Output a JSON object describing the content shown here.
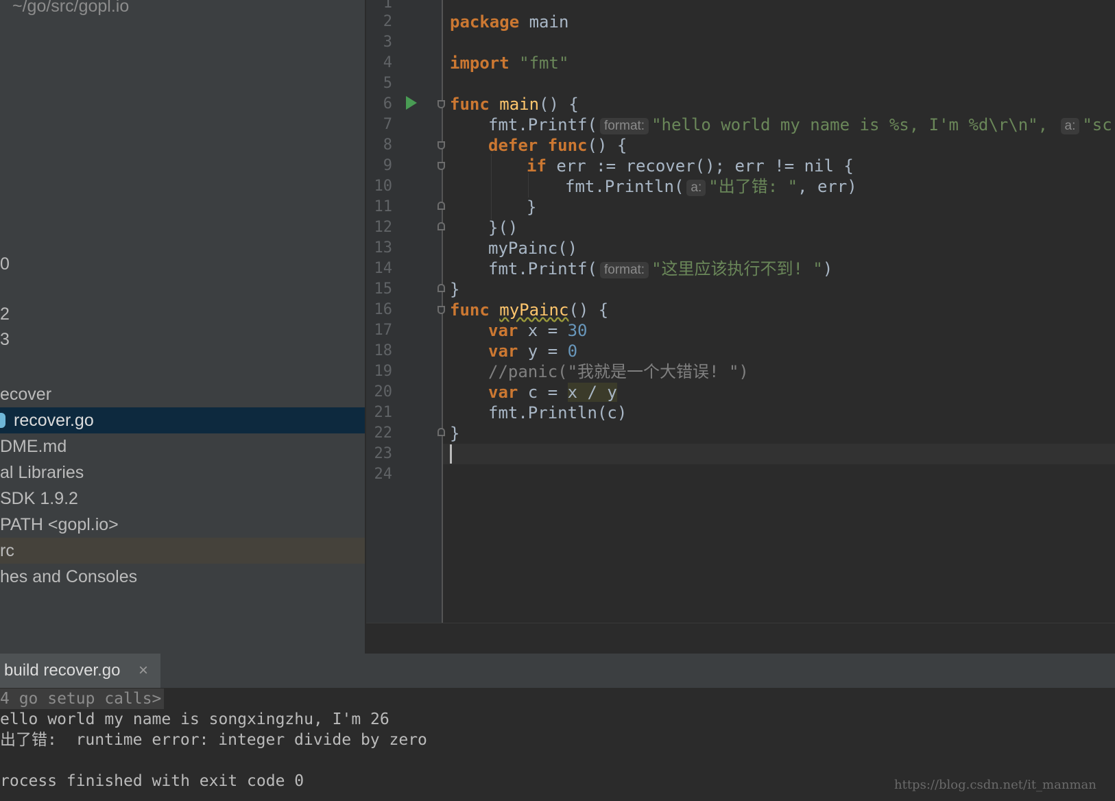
{
  "sidebar": {
    "path_hint": "~/go/src/gopl.io",
    "items": [
      {
        "label": "0"
      },
      {
        "label": "2"
      },
      {
        "label": "3"
      },
      {
        "label": "ecover"
      },
      {
        "label": "recover.go"
      },
      {
        "label": "DME.md"
      },
      {
        "label": "al Libraries"
      },
      {
        "label": "SDK 1.9.2"
      },
      {
        "label": "PATH <gopl.io>"
      },
      {
        "label": "rc"
      },
      {
        "label": "hes and Consoles"
      }
    ]
  },
  "editor": {
    "line_numbers": [
      "1",
      "2",
      "3",
      "4",
      "5",
      "6",
      "7",
      "8",
      "9",
      "10",
      "11",
      "12",
      "13",
      "14",
      "15",
      "16",
      "17",
      "18",
      "19",
      "20",
      "21",
      "22",
      "23",
      "24"
    ],
    "code": {
      "l2_kw": "package",
      "l2_rest": " main",
      "l4_kw": "import",
      "l4_str": "\"fmt\"",
      "l6_kw": "func",
      "l6_fn": "main",
      "l6_rest": "() {",
      "l7_a": "fmt.Printf(",
      "l7_hint1": "format:",
      "l7_str": "\"hello world my name is %s, I'm %d\\r\\n\",",
      "l7_hint2": "a:",
      "l7_str2": "\"sc",
      "l8_kw1": "defer",
      "l8_kw2": "func",
      "l8_rest": "() {",
      "l9_kw": "if",
      "l9_rest": " err := recover(); err != nil {",
      "l10_a": "fmt.Println(",
      "l10_hint": "a:",
      "l10_str": "\"出了错: \"",
      "l10_rest": ", err)",
      "l11": "}",
      "l12": "}()",
      "l13": "myPainc()",
      "l14_a": "fmt.Printf(",
      "l14_hint": "format:",
      "l14_str": "\"这里应该执行不到! \"",
      "l14_rest": ")",
      "l15": "}",
      "l16_kw": "func",
      "l16_fn": "myPainc",
      "l16_rest": "() {",
      "l17_kw": "var",
      "l17_rest": " x = ",
      "l17_num": "30",
      "l18_kw": "var",
      "l18_rest": " y = ",
      "l18_num": "0",
      "l19_cmt": "//panic(\"我就是一个大错误! \")",
      "l20_kw": "var",
      "l20_rest": " c = ",
      "l20_hl": "x / y",
      "l21": "fmt.Println(c)",
      "l22": "}"
    }
  },
  "run": {
    "tab_label": "build recover.go",
    "close_glyph": "×",
    "console": [
      "4 go setup calls>",
      "ello world my name is songxingzhu, I'm 26",
      "出了错:  runtime error: integer divide by zero",
      "",
      "rocess finished with exit code 0"
    ]
  },
  "watermark": "https://blog.csdn.net/it_manman",
  "colors": {
    "keyword": "#cc7832",
    "function": "#ffc66d",
    "string": "#6a8759",
    "number": "#6897bb",
    "comment": "#808080",
    "selection": "#0d293e"
  },
  "icons": [
    "run-gutter-icon",
    "go-file-icon",
    "fold-icon",
    "close-tab-icon"
  ]
}
